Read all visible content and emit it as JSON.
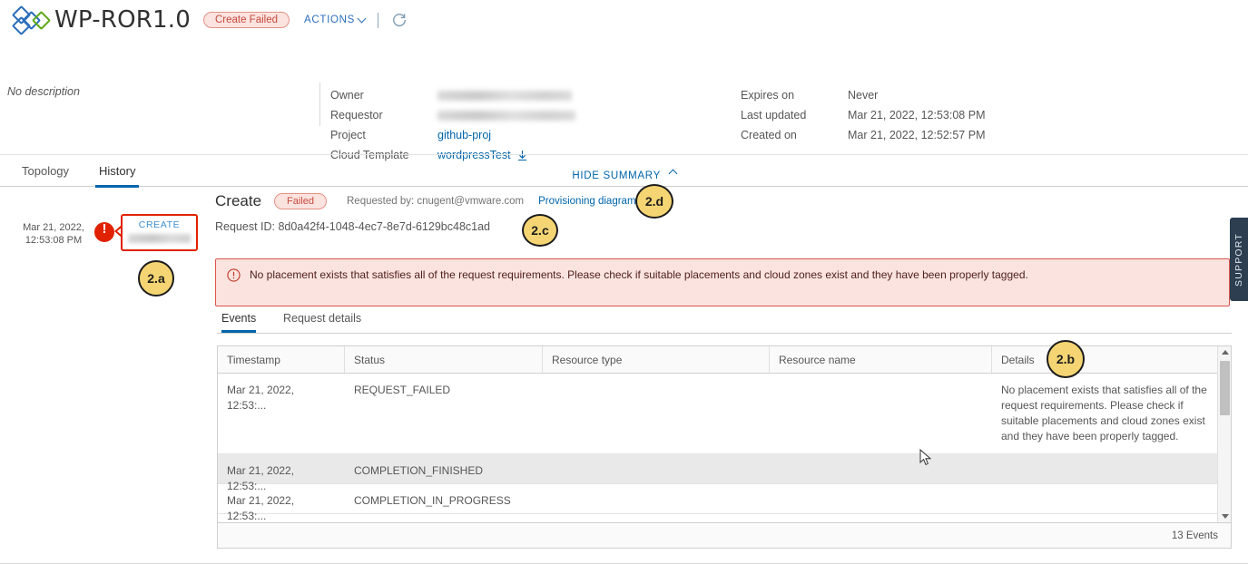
{
  "header": {
    "title": "WP-ROR1.0",
    "state_badge": "Create Failed",
    "actions_label": "ACTIONS",
    "refresh_icon": "refresh-icon",
    "logo_icon": "vmware-aria-logo-icon"
  },
  "summary": {
    "description": "No description",
    "hide_summary_label": "HIDE SUMMARY",
    "left": [
      {
        "label": "Owner",
        "value": "",
        "redacted": true
      },
      {
        "label": "Requestor",
        "value": "",
        "redacted": true
      },
      {
        "label": "Project",
        "value": "github-proj",
        "link": true
      },
      {
        "label": "Cloud Template",
        "value": "wordpressTest",
        "link": true,
        "download_icon": "download-icon"
      }
    ],
    "right": [
      {
        "label": "Expires on",
        "value": "Never"
      },
      {
        "label": "Last updated",
        "value": "Mar 21, 2022, 12:53:08 PM"
      },
      {
        "label": "Created on",
        "value": "Mar 21, 2022, 12:52:57 PM"
      }
    ]
  },
  "tabs": [
    {
      "label": "Topology",
      "selected": false
    },
    {
      "label": "History",
      "selected": true
    }
  ],
  "timeline": {
    "timestamp_line1": "Mar 21, 2022,",
    "timestamp_line2": "12:53:08 PM",
    "error_icon": "error-exclamation-icon",
    "card_title": "CREATE",
    "card_subtitle_redacted": true
  },
  "request": {
    "title": "Create",
    "status_badge": "Failed",
    "requested_by": "Requested by: cnugent@vmware.com",
    "provisioning_diagram_label": "Provisioning diagram",
    "request_id": "Request ID: 8d0a42f4-1048-4ec7-8e7d-6129bc48c1ad"
  },
  "alert": {
    "icon": "error-circle-icon",
    "message": "No placement exists that satisfies all of the request requirements. Please check if suitable placements and cloud zones exist and they have been properly tagged."
  },
  "inner_tabs": [
    {
      "label": "Events",
      "selected": true
    },
    {
      "label": "Request details",
      "selected": false
    }
  ],
  "events_table": {
    "columns": [
      "Timestamp",
      "Status",
      "Resource type",
      "Resource name",
      "Details"
    ],
    "rows": [
      {
        "timestamp": "Mar 21, 2022, 12:53:...",
        "status": "REQUEST_FAILED",
        "resource_type": "",
        "resource_name": "",
        "details": "No placement exists that satisfies all of the request requirements. Please check if suitable placements and cloud zones exist and they have been properly tagged."
      },
      {
        "timestamp": "Mar 21, 2022, 12:53:...",
        "status": "COMPLETION_FINISHED",
        "resource_type": "",
        "resource_name": "",
        "details": ""
      },
      {
        "timestamp": "Mar 21, 2022, 12:53:...",
        "status": "COMPLETION_IN_PROGRESS",
        "resource_type": "",
        "resource_name": "",
        "details": ""
      }
    ],
    "footer_count": "13 Events"
  },
  "support_tab": {
    "label": "SUPPORT",
    "icon": "chevron-left-double-icon"
  },
  "callouts": [
    {
      "id": "2.a",
      "label": "2.a"
    },
    {
      "id": "2.b",
      "label": "2.b"
    },
    {
      "id": "2.c",
      "label": "2.c"
    },
    {
      "id": "2.d",
      "label": "2.d"
    }
  ],
  "colors": {
    "accent_blue": "#0065ab",
    "error_red": "#e02200",
    "alert_bg": "#fbe3df",
    "alert_border": "#d9534f",
    "callout_yellow": "#f5d573",
    "logo_blue": "#2a6ebb",
    "logo_green": "#60a917"
  }
}
